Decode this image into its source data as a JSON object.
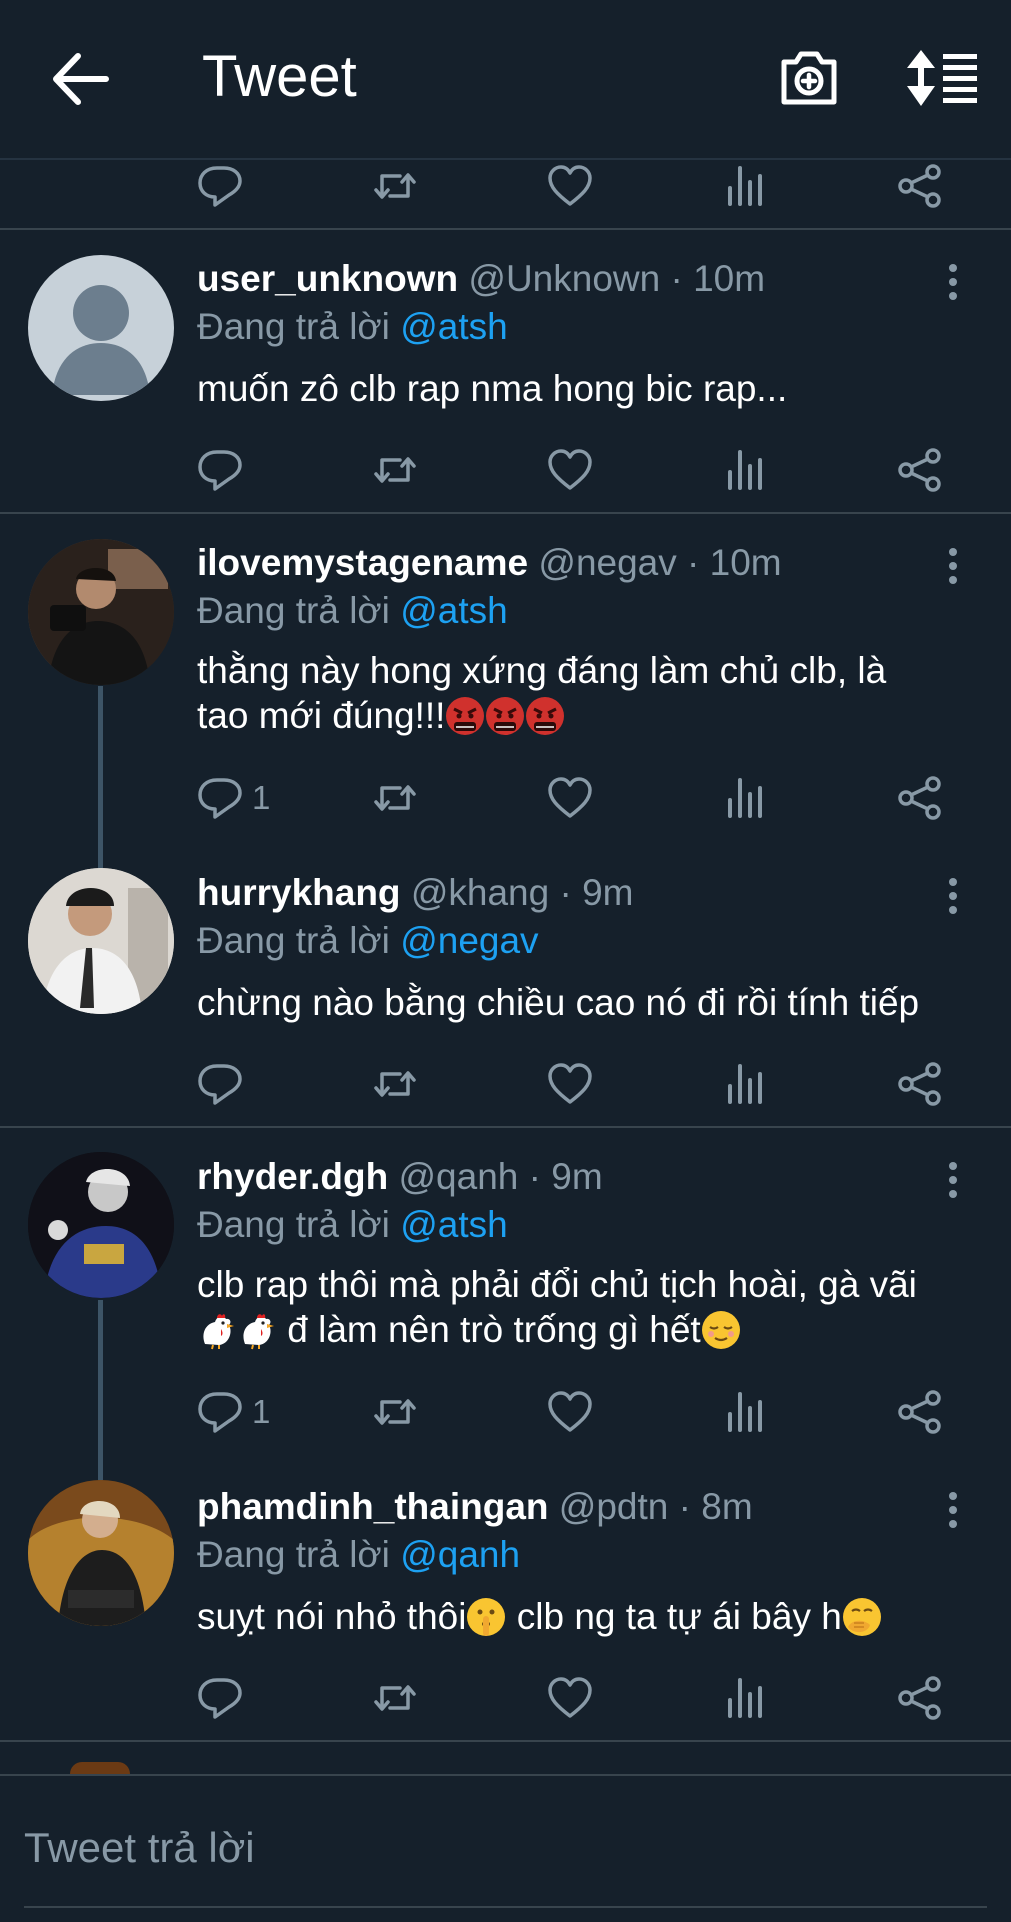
{
  "header": {
    "title": "Tweet"
  },
  "tweets": [
    {
      "name": "user_unknown",
      "meta": "@Unknown · 10m",
      "replying_label": "Đang trả lời",
      "replying_to": "@atsh",
      "text": "muốn zô clb rap nma hong bic rap...",
      "reply_count": ""
    },
    {
      "name": "ilovemystagename",
      "meta": "@negav · 10m",
      "replying_label": "Đang trả lời",
      "replying_to": "@atsh",
      "text_line1": "thằng này hong xứng đáng làm chủ clb, là",
      "text_line2": "tao mới đúng!!!",
      "reply_count": "1"
    },
    {
      "name": "hurrykhang",
      "meta": "@khang · 9m",
      "replying_label": "Đang trả lời",
      "replying_to": "@negav",
      "text": "chừng nào bằng chiều cao nó đi rồi tính tiếp",
      "reply_count": ""
    },
    {
      "name": "rhyder.dgh",
      "meta": "@qanh · 9m",
      "replying_label": "Đang trả lời",
      "replying_to": "@atsh",
      "text_line1": "clb rap thôi mà phải đổi chủ tịch hoài, gà vãi",
      "text_line2": " đ làm nên trò trống gì hết",
      "reply_count": "1"
    },
    {
      "name": "phamdinh_thaingan",
      "meta": "@pdtn · 8m",
      "replying_label": "Đang trả lời",
      "replying_to": "@qanh",
      "text_a": "suỵt nói nhỏ thôi",
      "text_b": " clb ng ta tự ái bây h",
      "reply_count": ""
    }
  ],
  "compose": {
    "placeholder": "Tweet trả lời"
  }
}
